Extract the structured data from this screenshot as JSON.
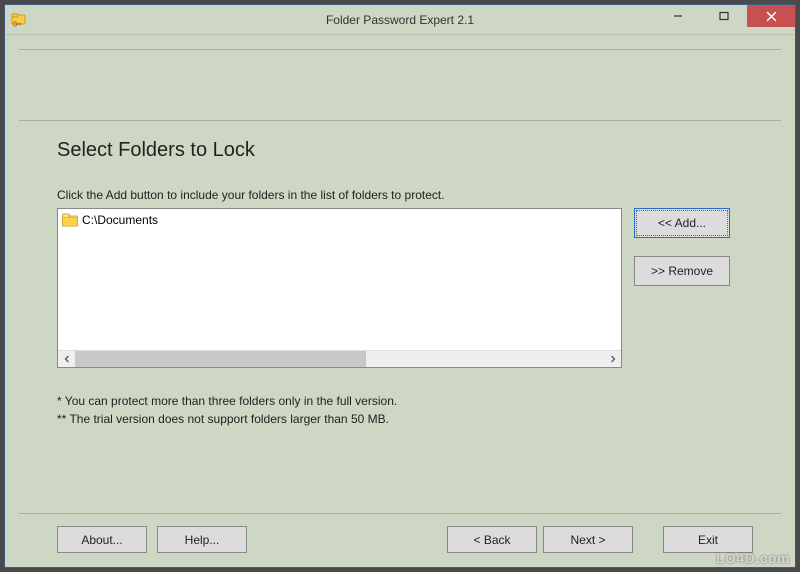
{
  "window": {
    "title": "Folder Password Expert 2.1"
  },
  "main": {
    "heading": "Select Folders to Lock",
    "instruction": "Click the Add button to include your folders in the list of folders to protect.",
    "folders": [
      {
        "icon": "folder-icon",
        "path": "C:\\Documents"
      }
    ],
    "note1": "*  You can protect more than three folders only in the full version.",
    "note2": "** The trial version does not support folders larger than 50 MB."
  },
  "buttons": {
    "add": "<<   Add...",
    "remove": ">> Remove",
    "about": "About...",
    "help": "Help...",
    "back": "< Back",
    "next": "Next >",
    "exit": "Exit"
  },
  "watermark": "LO4D.com"
}
